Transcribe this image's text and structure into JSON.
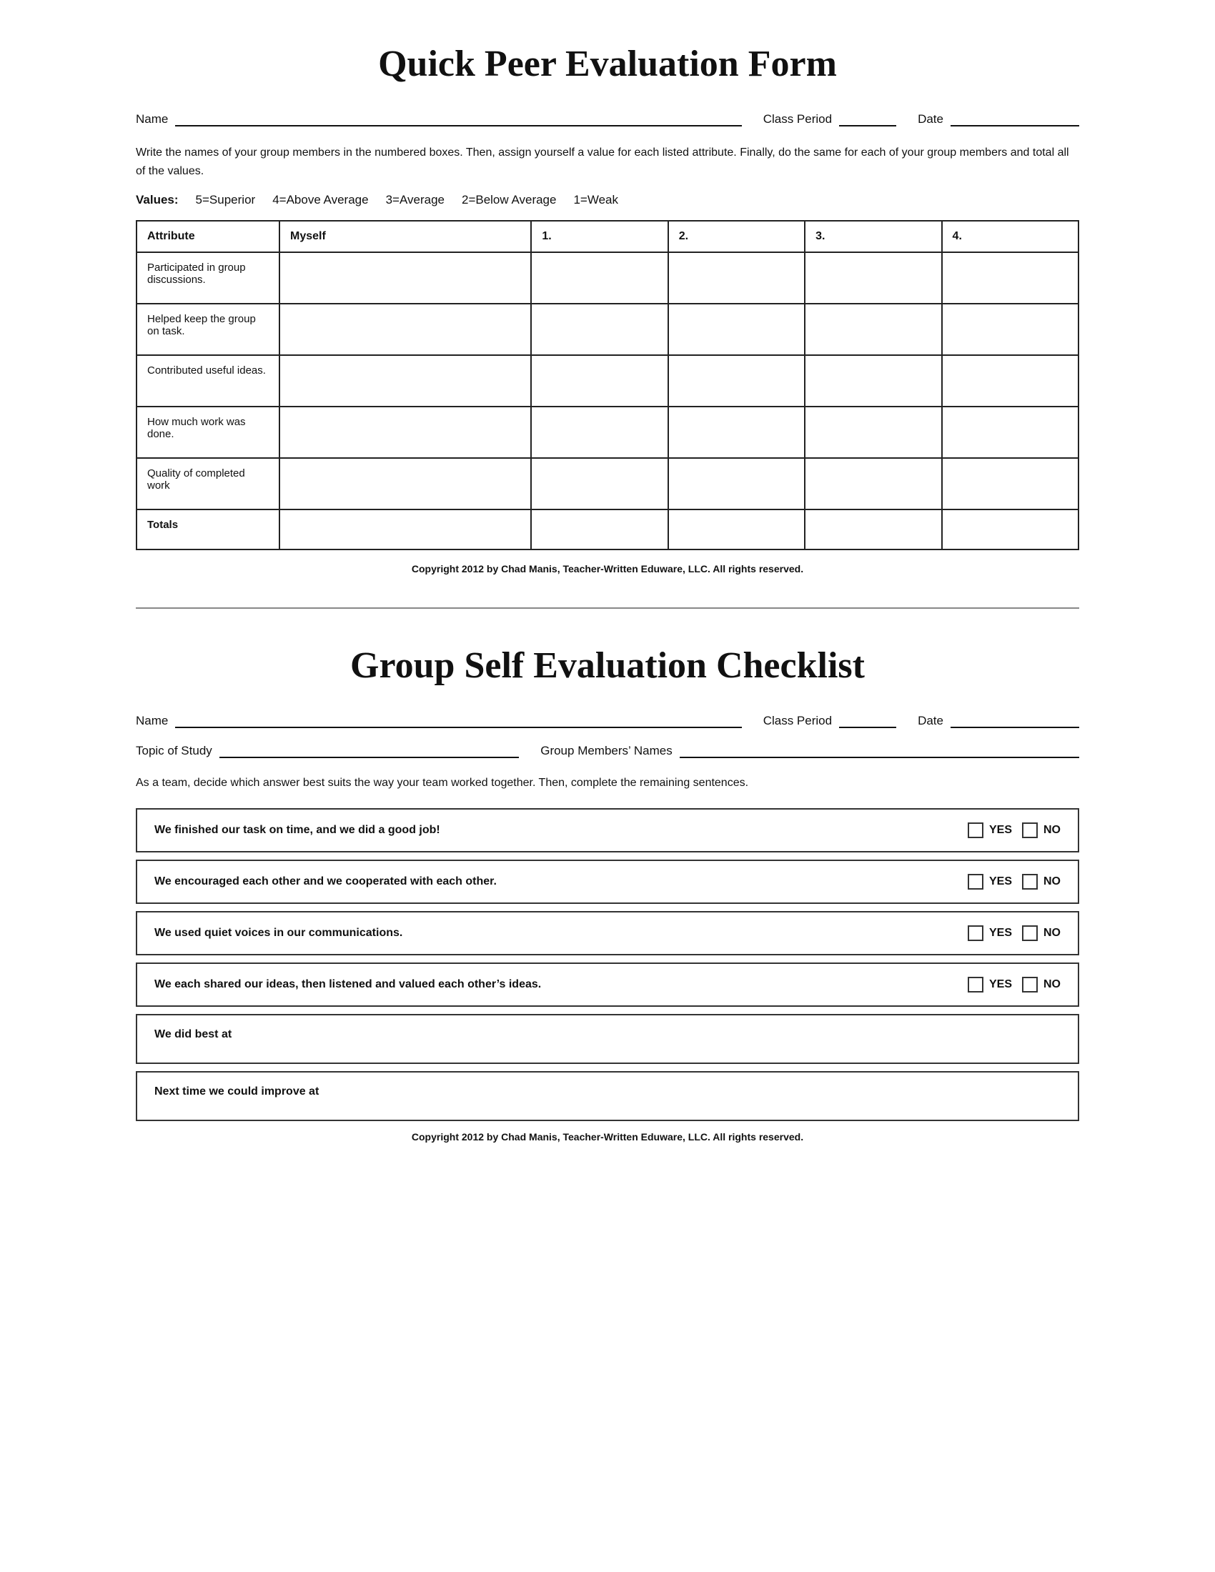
{
  "section1": {
    "title": "Quick Peer Evaluation Form",
    "name_label": "Name",
    "class_period_label": "Class Period",
    "date_label": "Date",
    "instructions": "Write the names of your group members in the numbered boxes.  Then,  assign yourself a value for each listed attribute.  Finally, do the same for each of your group members and total all of the values.",
    "values_label": "Values:",
    "values": [
      "5=Superior",
      "4=Above Average",
      "3=Average",
      "2=Below Average",
      "1=Weak"
    ],
    "table": {
      "headers": [
        "Attribute",
        "Myself",
        "1.",
        "2.",
        "3.",
        "4."
      ],
      "rows": [
        {
          "attribute": "Participated in group discussions."
        },
        {
          "attribute": "Helped keep the group on task."
        },
        {
          "attribute": "Contributed useful ideas."
        },
        {
          "attribute": "How much work was done."
        },
        {
          "attribute": "Quality of completed work"
        },
        {
          "attribute": "Totals",
          "is_total": true
        }
      ]
    },
    "copyright": "Copyright 2012 by Chad Manis, Teacher-Written Eduware, LLC.  All rights reserved."
  },
  "section2": {
    "title": "Group Self Evaluation Checklist",
    "name_label": "Name",
    "class_period_label": "Class Period",
    "date_label": "Date",
    "topic_label": "Topic of Study",
    "group_members_label": "Group Members’ Names",
    "instructions": "As a team, decide which answer best suits the way your team worked together.  Then, complete the remaining sentences.",
    "checklist_items": [
      {
        "text": "We finished our task on time, and we did a good job!",
        "yes": "YES",
        "no": "NO"
      },
      {
        "text": "We encouraged each other and we cooperated with each other.",
        "yes": "YES",
        "no": "NO"
      },
      {
        "text": "We used quiet voices in our communications.",
        "yes": "YES",
        "no": "NO"
      },
      {
        "text": "We each shared our ideas, then listened and valued each other’s ideas.",
        "yes": "YES",
        "no": "NO"
      }
    ],
    "open_items": [
      {
        "text": "We did best at"
      },
      {
        "text": "Next time we could improve at"
      }
    ],
    "copyright": "Copyright 2012 by Chad Manis, Teacher-Written Eduware, LLC.  All rights reserved."
  }
}
